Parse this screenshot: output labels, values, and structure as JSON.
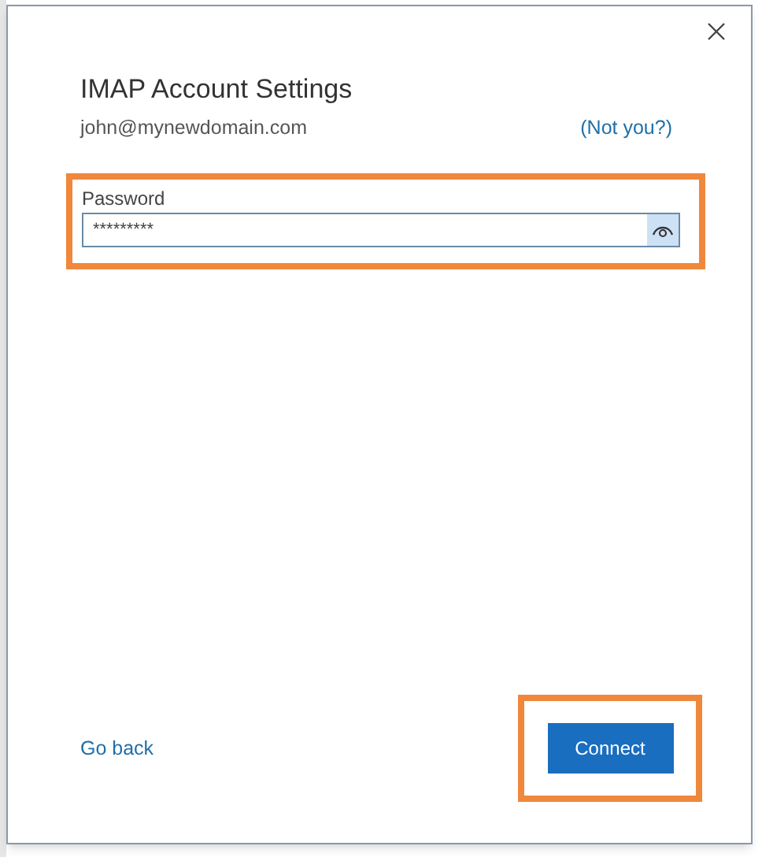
{
  "dialog": {
    "title": "IMAP Account Settings",
    "account": "john@mynewdomain.com",
    "not_you_link": "(Not you?)"
  },
  "password": {
    "label": "Password",
    "value": "*********",
    "reveal_hovered": true
  },
  "footer": {
    "back_link": "Go back",
    "connect_button": "Connect"
  }
}
